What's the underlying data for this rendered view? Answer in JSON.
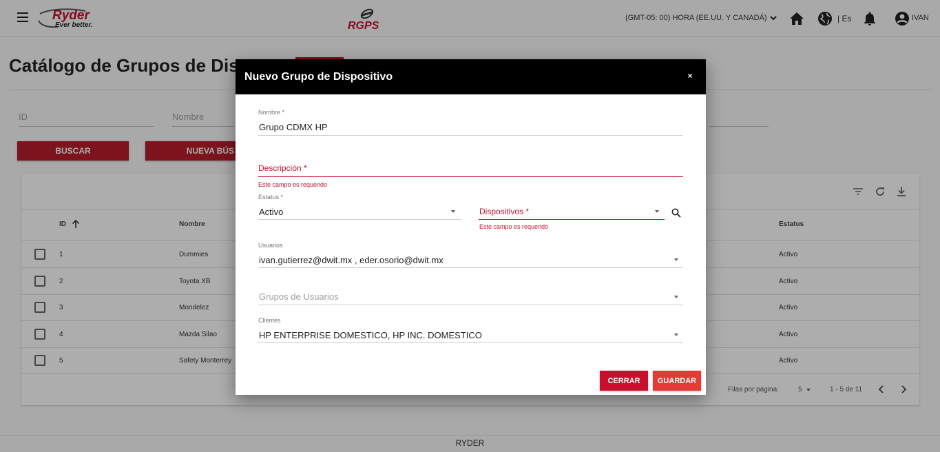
{
  "header": {
    "brand_name": "Ryder",
    "brand_tagline": "Ever better.",
    "app_logo": "RGPS",
    "timezone": "(GMT-05: 00) HORA (EE.UU. Y CANADÁ)",
    "language": "| Es",
    "user": "IVAN",
    "icons": [
      "menu-icon",
      "home-icon",
      "globe-icon",
      "bell-icon",
      "account-circle-icon"
    ]
  },
  "page": {
    "title": "Catálogo de Grupos de Dispo"
  },
  "filters": {
    "id_placeholder": "ID",
    "nombre_placeholder": "Nombre",
    "buscar": "BUSCAR",
    "nueva_busqueda": "NUEVA BÚS"
  },
  "table": {
    "headers": {
      "id": "ID",
      "nombre": "Nombre",
      "estatus": "Estatus"
    },
    "rows": [
      {
        "id": "1",
        "nombre": "Dummies",
        "estatus": "Activo"
      },
      {
        "id": "2",
        "nombre": "Toyota XB",
        "estatus": "Activo"
      },
      {
        "id": "3",
        "nombre": "Mondelez",
        "estatus": "Activo"
      },
      {
        "id": "4",
        "nombre": "Mazda Silao",
        "estatus": "Activo"
      },
      {
        "id": "5",
        "nombre": "Safety Monterrey",
        "estatus": "Activo"
      }
    ],
    "pager": {
      "rows_label": "Filas por página:",
      "rows_value": "5",
      "range": "1 - 5 de 11"
    }
  },
  "footer": {
    "text": "RYDER"
  },
  "modal": {
    "title": "Nuevo Grupo de Dispositivo",
    "close": "×",
    "nombre_label": "Nombre *",
    "nombre_value": "Grupo CDMX HP",
    "descripcion_label": "Descripción *",
    "descripcion_error": "Este campo es requerido",
    "estatus_label": "Estatus *",
    "estatus_value": "Activo",
    "dispositivos_label": "Dispositivos *",
    "dispositivos_error": "Este campo es requerido",
    "usuarios_label": "Usuarios",
    "usuarios_value": "ivan.gutierrez@dwit.mx , eder.osorio@dwit.mx",
    "grupos_placeholder": "Grupos de Usuarios",
    "clientes_label": "Clientes",
    "clientes_value": "HP ENTERPRISE DOMESTICO, HP INC. DOMESTICO",
    "cerrar": "CERRAR",
    "guardar": "GUARDAR",
    "colors": {
      "cerrar": "#c8102e",
      "guardar": "#e53935",
      "error": "#c8102e"
    }
  }
}
